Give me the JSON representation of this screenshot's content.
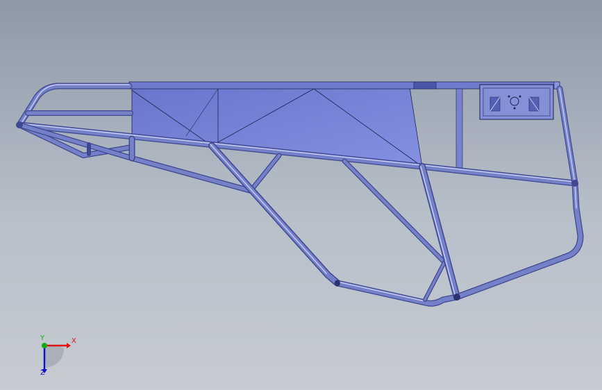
{
  "viewport": {
    "background_top": "#8e99a8",
    "background_bottom": "#c7cbd2"
  },
  "model": {
    "tube_color": "#7480c8",
    "tube_dark": "#3e4790",
    "tube_highlight": "#c5cbf2",
    "panel_color": "#7a86d8",
    "panel_dark": "#5d69c0",
    "edge_color": "#1d2350"
  },
  "triad": {
    "x_label": "X",
    "y_label": "Y",
    "z_label": "Z",
    "x_color": "#dd1111",
    "y_color": "#11aa11",
    "z_color": "#1111cc"
  }
}
